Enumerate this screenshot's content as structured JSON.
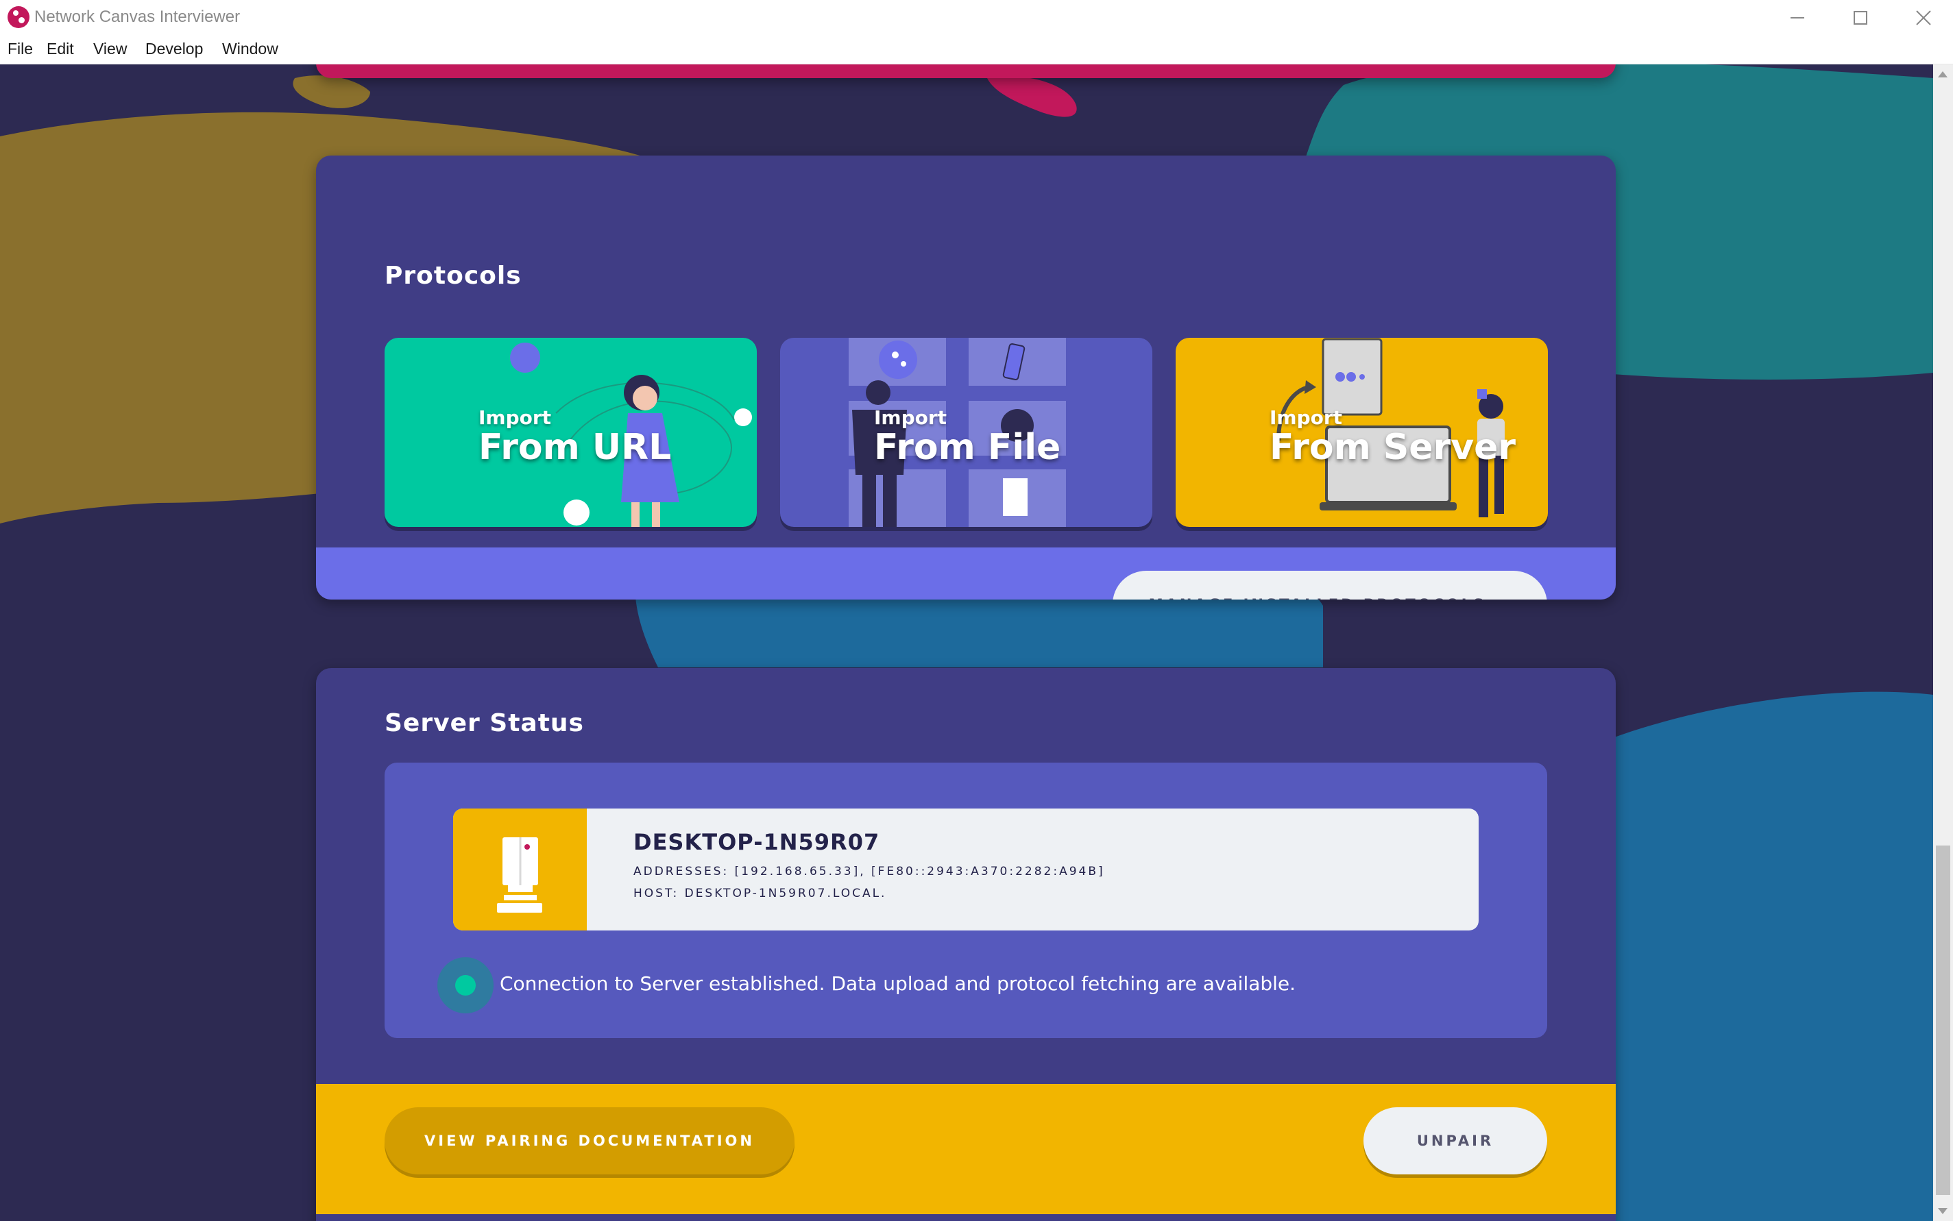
{
  "window": {
    "title": "Network Canvas Interviewer",
    "controls": [
      "minimize-icon",
      "maximize-icon",
      "close-icon"
    ]
  },
  "menubar": {
    "items": [
      "File",
      "Edit",
      "View",
      "Develop",
      "Window"
    ]
  },
  "protocols": {
    "heading": "Protocols",
    "cards": [
      {
        "prefix": "Import",
        "title": "From URL",
        "color": "#00c9a0"
      },
      {
        "prefix": "Import",
        "title": "From File",
        "color": "#5659bd"
      },
      {
        "prefix": "Import",
        "title": "From Server",
        "color": "#f2b500"
      }
    ],
    "manage_button": "MANAGE INSTALLED PROTOCOLS..."
  },
  "server_status": {
    "heading": "Server Status",
    "server_name": "DESKTOP-1N59R07",
    "addresses": "ADDRESSES: [192.168.65.33], [FE80::2943:A370:2282:A94B]",
    "host": "HOST: DESKTOP-1N59R07.LOCAL.",
    "status_message": "Connection to Server established. Data upload and protocol fetching are available.",
    "view_docs_button": "VIEW PAIRING DOCUMENTATION",
    "unpair_button": "UNPAIR"
  },
  "colors": {
    "background": "#2d2a52",
    "panel": "#403d85",
    "panel_footer": "#6b6ee8",
    "accent_yellow": "#f2b500",
    "accent_teal": "#00c9a0",
    "accent_pink": "#c2185b"
  }
}
